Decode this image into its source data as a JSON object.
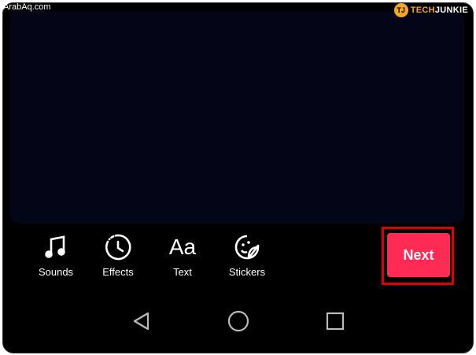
{
  "watermarks": {
    "left": "ArabAq.com",
    "brand_badge": "TJ",
    "brand_tech": "TECH",
    "brand_junkie": "JUNKIE"
  },
  "toolbar": {
    "items": [
      {
        "label": "Sounds",
        "icon": "music-note-icon"
      },
      {
        "label": "Effects",
        "icon": "timer-effects-icon"
      },
      {
        "label": "Text",
        "icon": "text-aa-icon",
        "glyph": "Aa"
      },
      {
        "label": "Stickers",
        "icon": "sticker-icon"
      }
    ],
    "next_label": "Next"
  },
  "navbar": {
    "items": [
      "back-icon",
      "home-icon",
      "recents-icon"
    ]
  },
  "colors": {
    "accent": "#fe2c55",
    "highlight": "#e00000",
    "preview_bg": "#020617",
    "brand": "#f5a623"
  }
}
